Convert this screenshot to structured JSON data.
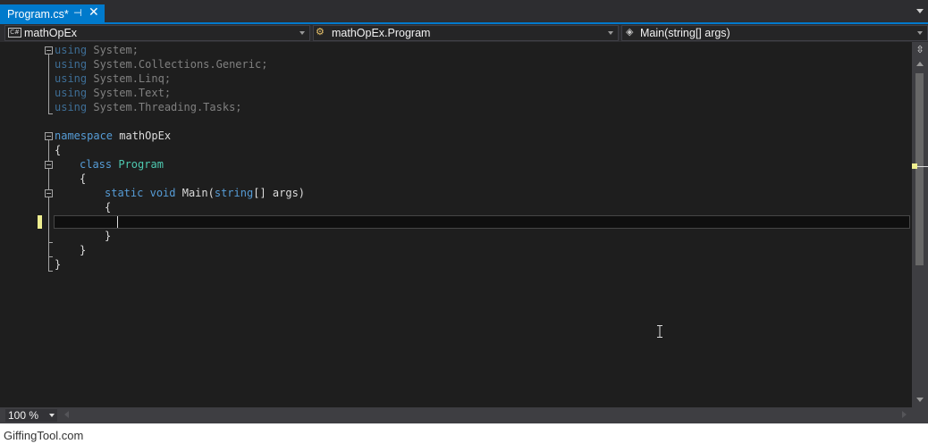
{
  "tab": {
    "title": "Program.cs*",
    "pin_icon": "pin-icon",
    "close_icon": "close-icon"
  },
  "navbar": {
    "project": "mathOpEx",
    "type": "mathOpEx.Program",
    "member": "Main(string[] args)"
  },
  "code": {
    "l1": {
      "kw": "using",
      "rest": " System;"
    },
    "l2": {
      "kw": "using",
      "rest": " System.Collections.Generic;"
    },
    "l3": {
      "kw": "using",
      "rest": " System.Linq;"
    },
    "l4": {
      "kw": "using",
      "rest": " System.Text;"
    },
    "l5": {
      "kw": "using",
      "rest": " System.Threading.Tasks;"
    },
    "l7": {
      "kw": "namespace",
      "rest": " mathOpEx"
    },
    "l8": "{",
    "l9": {
      "kw": "class",
      "type": "Program"
    },
    "l10": "{",
    "l11": {
      "kw1": "static",
      "kw2": "void",
      "name": " Main(",
      "kw3": "string",
      "rest": "[] args)"
    },
    "l12": "{",
    "l14": "}",
    "l15": "}",
    "l16": "}"
  },
  "zoom": {
    "value": "100 %"
  },
  "watermark": "GiffingTool.com",
  "colors": {
    "accent": "#007acc",
    "editor_bg": "#1e1e1e",
    "keyword": "#569cd6",
    "type": "#4ec9b0"
  }
}
